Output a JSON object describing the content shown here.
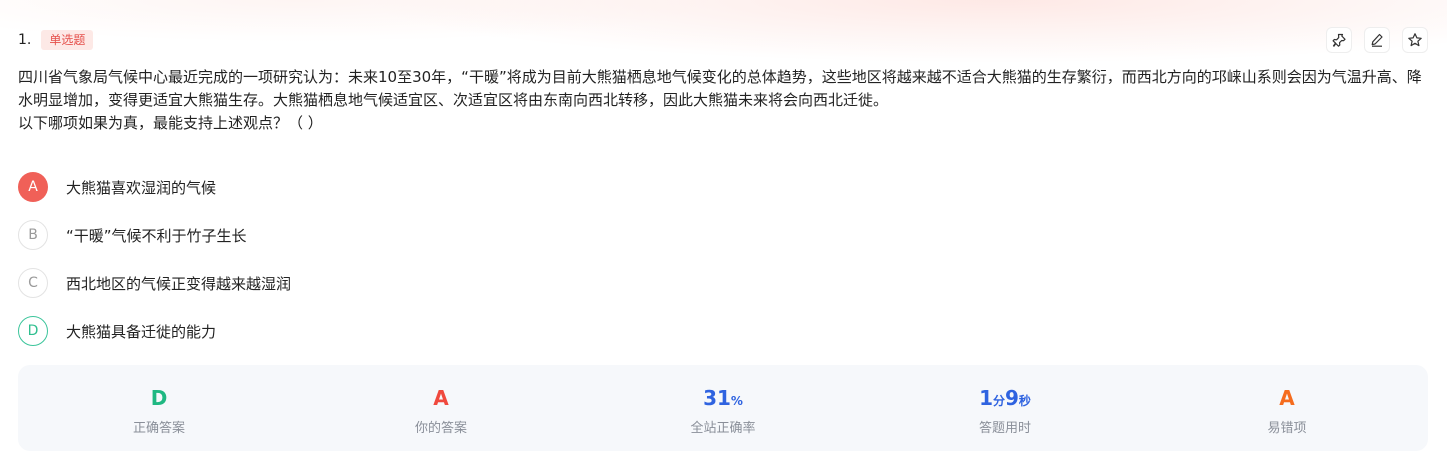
{
  "question": {
    "number": "1.",
    "type_tag": "单选题",
    "stem_line1": "四川省气象局气候中心最近完成的一项研究认为：未来10至30年，“干暖”将成为目前大熊猫栖息地气候变化的总体趋势，这些地区将越来越不适合大熊猫的生存繁衍，而西北方向的邛崃山系则会因为气温升高、降水明显增加，变得更适宜大熊猫生存。大熊猫栖息地气候适宜区、次适宜区将由东南向西北转移，因此大熊猫未来将会向西北迁徙。",
    "stem_line2": "以下哪项如果为真，最能支持上述观点？（ ）"
  },
  "toolbar": {
    "icons": [
      "pin-icon",
      "edit-icon",
      "star-icon"
    ]
  },
  "options": [
    {
      "letter": "A",
      "text": "大熊猫喜欢湿润的气候",
      "state": "selected-wrong"
    },
    {
      "letter": "B",
      "text": "“干暖”气候不利于竹子生长",
      "state": "default"
    },
    {
      "letter": "C",
      "text": "西北地区的气候正变得越来越湿润",
      "state": "default"
    },
    {
      "letter": "D",
      "text": "大熊猫具备迁徙的能力",
      "state": "correct"
    }
  ],
  "stats": {
    "correct_answer": {
      "value": "D",
      "label": "正确答案",
      "color": "#1fb882"
    },
    "your_answer": {
      "value": "A",
      "label": "你的答案",
      "color": "#f0493e"
    },
    "accuracy": {
      "value": "31",
      "unit": "%",
      "label": "全站正确率",
      "color": "#2f63e0"
    },
    "time": {
      "minutes": "1",
      "min_unit": "分",
      "seconds": "9",
      "sec_unit": "秒",
      "label": "答题用时",
      "color": "#2f63e0"
    },
    "common_mistake": {
      "value": "A",
      "label": "易错项",
      "color": "#f56c1e"
    }
  }
}
